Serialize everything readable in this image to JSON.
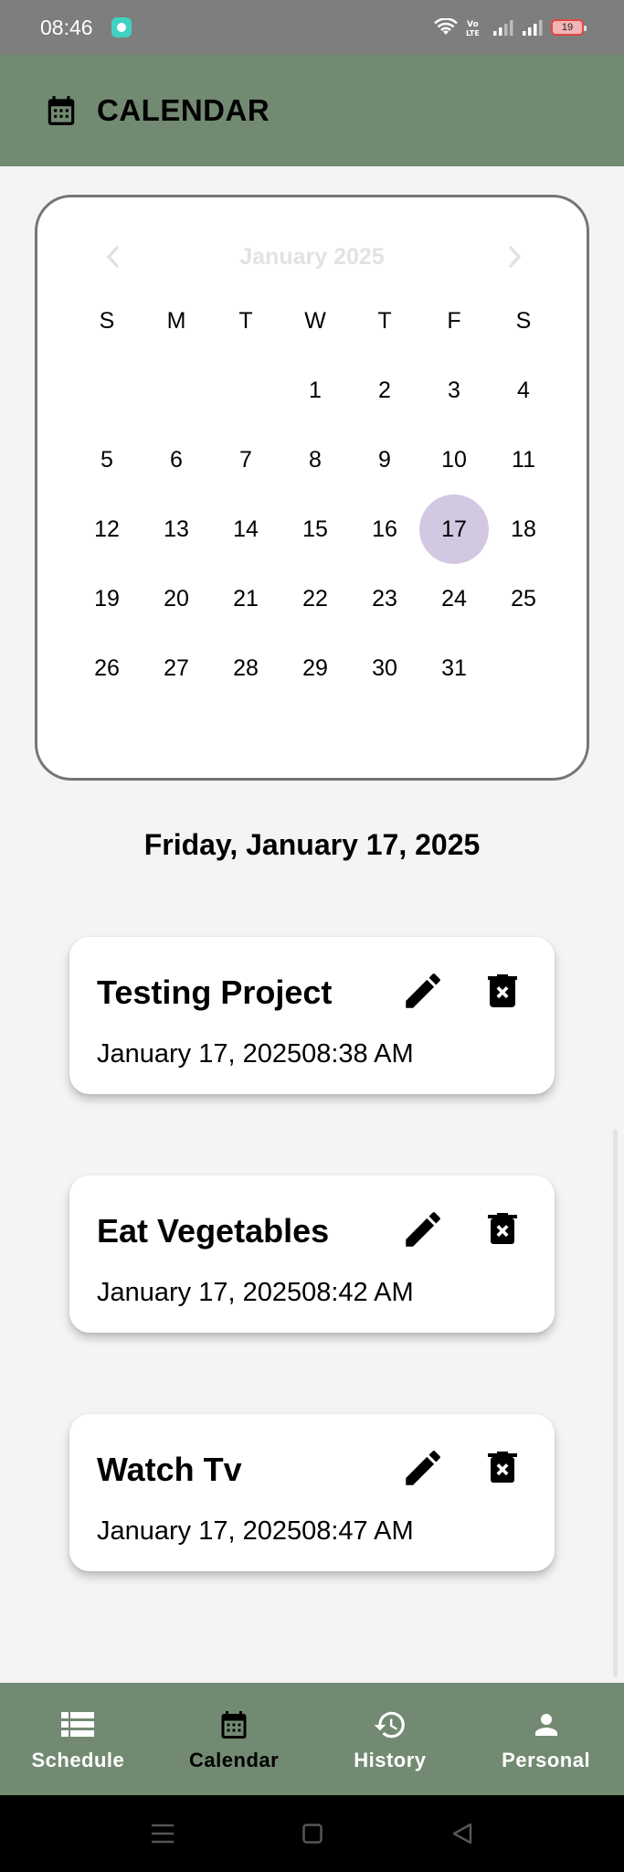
{
  "status_bar": {
    "time": "08:46",
    "battery": "19",
    "icons": [
      "chat-app-icon",
      "wifi-icon",
      "volte-icon",
      "signal-icon",
      "signal-icon",
      "battery-icon"
    ]
  },
  "app_bar": {
    "title": "CALENDAR",
    "icon": "calendar-icon"
  },
  "calendar": {
    "month_label": "January 2025",
    "weekdays": [
      "S",
      "M",
      "T",
      "W",
      "T",
      "F",
      "S"
    ],
    "leading_blanks": 3,
    "days": [
      "1",
      "2",
      "3",
      "4",
      "5",
      "6",
      "7",
      "8",
      "9",
      "10",
      "11",
      "12",
      "13",
      "14",
      "15",
      "16",
      "17",
      "18",
      "19",
      "20",
      "21",
      "22",
      "23",
      "24",
      "25",
      "26",
      "27",
      "28",
      "29",
      "30",
      "31"
    ],
    "selected_day": "17",
    "selected_color": "#d3c8e2"
  },
  "selected_date_label": "Friday, January 17, 2025",
  "events": [
    {
      "title": "Testing Project",
      "datetime": "January 17, 202508:38 AM"
    },
    {
      "title": "Eat Vegetables",
      "datetime": "January 17, 202508:42 AM"
    },
    {
      "title": "Watch Tv",
      "datetime": "January 17, 202508:47 AM"
    }
  ],
  "bottom_nav": {
    "active": "Calendar",
    "items": [
      {
        "label": "Schedule",
        "icon": "list-icon"
      },
      {
        "label": "Calendar",
        "icon": "calendar-icon"
      },
      {
        "label": "History",
        "icon": "history-icon"
      },
      {
        "label": "Personal",
        "icon": "person-icon"
      }
    ]
  },
  "colors": {
    "app_bar": "#728a72",
    "status_bar": "#7e7e7e",
    "background": "#f4f4f4"
  }
}
